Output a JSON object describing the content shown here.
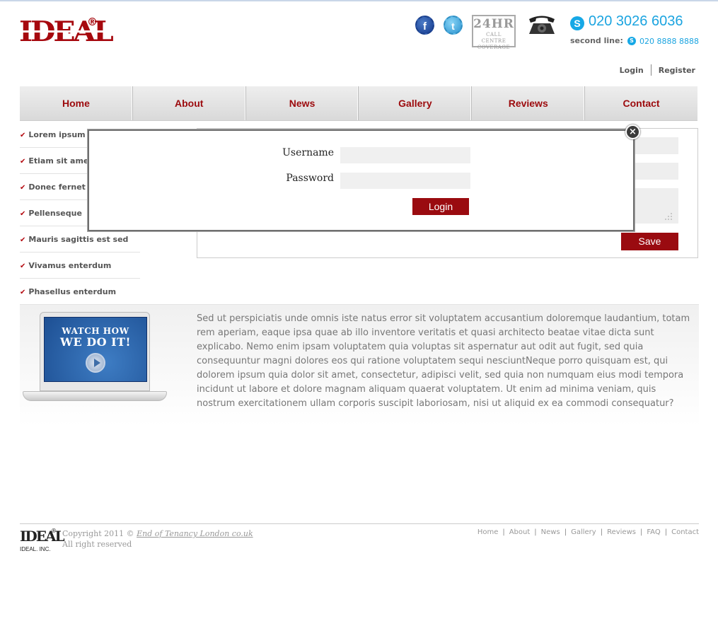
{
  "header": {
    "logo_text": "IDEAL",
    "logo_reg": "®",
    "facebook_icon": "f",
    "twitter_icon": "t",
    "badge_24hr": "24HR",
    "badge_line1": "CALL CENTRE",
    "badge_line2": "COVERAGE",
    "phone_main": "020 3026 6036",
    "second_line_label": "second line:",
    "phone_second": "020 8888 8888",
    "skype_icon": "S"
  },
  "auth": {
    "login": "Login",
    "register": "Register"
  },
  "nav": {
    "items": [
      "Home",
      "About",
      "News",
      "Gallery",
      "Reviews",
      "Contact"
    ]
  },
  "sidebar": {
    "items": [
      "Lorem ipsum",
      "Etiam sit ame",
      "Donec fernet",
      "Pellenseque",
      "Mauris sagittis est sed",
      "Vivamus enterdum",
      "Phasellus enterdum"
    ]
  },
  "form": {
    "save_label": "Save"
  },
  "promo": {
    "video_line1": "WATCH HOW",
    "video_line2": "WE DO IT!",
    "text": "Sed ut perspiciatis unde omnis iste natus error sit voluptatem accusantium doloremque laudantium, totam rem aperiam, eaque ipsa quae ab illo inventore veritatis et quasi architecto beatae vitae dicta sunt explicabo. Nemo enim ipsam voluptatem quia voluptas sit aspernatur aut odit aut fugit, sed quia consequuntur magni dolores eos qui ratione voluptatem sequi nesciuntNeque porro quisquam est, qui dolorem ipsum quia dolor sit amet, consectetur, adipisci velit, sed quia non numquam eius modi tempora incidunt ut labore et dolore magnam aliquam quaerat voluptatem. Ut enim ad minima veniam, quis nostrum exercitationem ullam corporis suscipit laboriosam, nisi ut aliquid ex ea commodi consequatur?"
  },
  "footer": {
    "logo_text": "IDEAL",
    "logo_reg": "®",
    "logo_sub": "IDEAL. INC.",
    "copyright_prefix": "Copyright 2011 ©",
    "copyright_link": "End of Tenancy London co.uk",
    "rights": "All right reserved",
    "links": [
      "Home",
      "About",
      "News",
      "Gallery",
      "Reviews",
      "FAQ",
      "Contact"
    ]
  },
  "modal": {
    "username_label": "Username",
    "username_value": "",
    "password_label": "Password",
    "password_value": "",
    "login_button": "Login",
    "close_icon": "×"
  },
  "colors": {
    "brand_red": "#9a0b10",
    "phone_blue": "#1ba4e0"
  }
}
